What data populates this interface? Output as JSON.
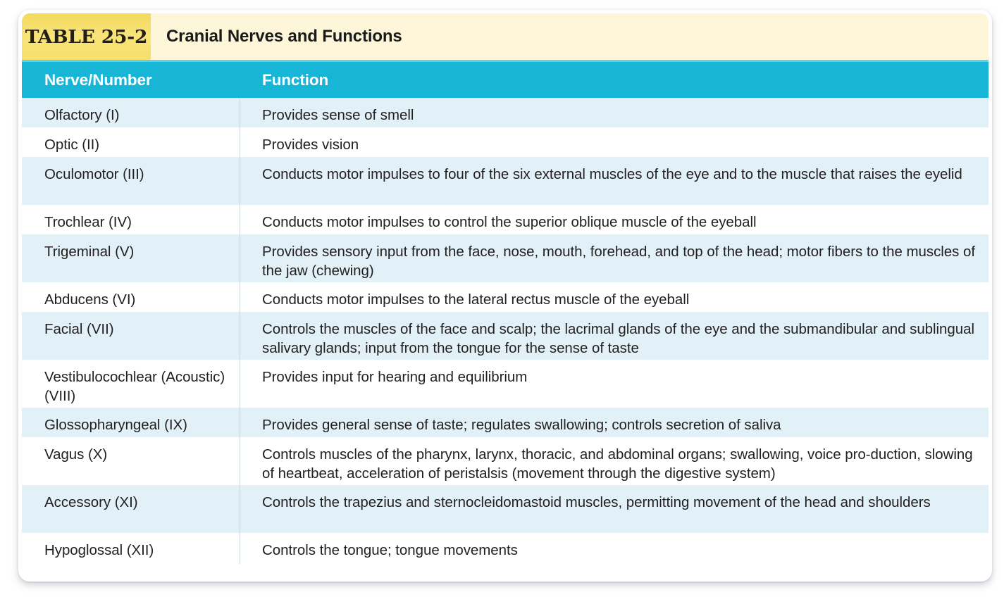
{
  "caption": {
    "badge": "TABLE 25-2",
    "title": "Cranial Nerves and Functions"
  },
  "colors": {
    "badge_yellow": "#f7e06a",
    "caption_cream": "#fdf6d9",
    "header_cyan": "#17b6d6",
    "header_cyan_top": "#5ed2e6",
    "stripe_blue": "#e2f1f7",
    "text": "#231f20",
    "divider": "#c9d7dd"
  },
  "columns": [
    {
      "key": "nerve",
      "label": "Nerve/Number"
    },
    {
      "key": "function",
      "label": "Function"
    }
  ],
  "rows": [
    {
      "nerve": "Olfactory (I)",
      "function": "Provides sense of smell"
    },
    {
      "nerve": "Optic (II)",
      "function": "Provides vision"
    },
    {
      "nerve": "Oculomotor (III)",
      "function": "Conducts motor impulses to four of the six external muscles of the eye and to the muscle that raises the eyelid"
    },
    {
      "nerve": "Trochlear (IV)",
      "function": "Conducts motor impulses to control the superior oblique muscle of the eyeball"
    },
    {
      "nerve": "Trigeminal (V)",
      "function": "Provides sensory input from the face, nose, mouth, forehead, and top of the head; motor fibers to the muscles of the jaw (chewing)"
    },
    {
      "nerve": "Abducens (VI)",
      "function": "Conducts motor impulses to the lateral rectus muscle of the eyeball"
    },
    {
      "nerve": "Facial (VII)",
      "function": "Controls the muscles of the face and scalp; the lacrimal glands of the eye and the submandibular and sublingual salivary glands; input from the tongue for the sense of taste"
    },
    {
      "nerve": "Vestibulocochlear (Acoustic) (VIII)",
      "function": "Provides input for hearing and equilibrium"
    },
    {
      "nerve": "Glossopharyngeal (IX)",
      "function": "Provides general sense of taste; regulates swallowing; controls secretion of saliva"
    },
    {
      "nerve": "Vagus (X)",
      "function": "Controls muscles of the pharynx, larynx, thoracic, and abdominal organs; swallowing, voice pro-duction, slowing of heartbeat, acceleration of peristalsis (movement through the digestive system)"
    },
    {
      "nerve": "Accessory (XI)",
      "function": "Controls the trapezius and sternocleidomastoid muscles, permitting movement of the head and shoulders"
    },
    {
      "nerve": "Hypoglossal (XII)",
      "function": "Controls the tongue; tongue movements"
    }
  ]
}
